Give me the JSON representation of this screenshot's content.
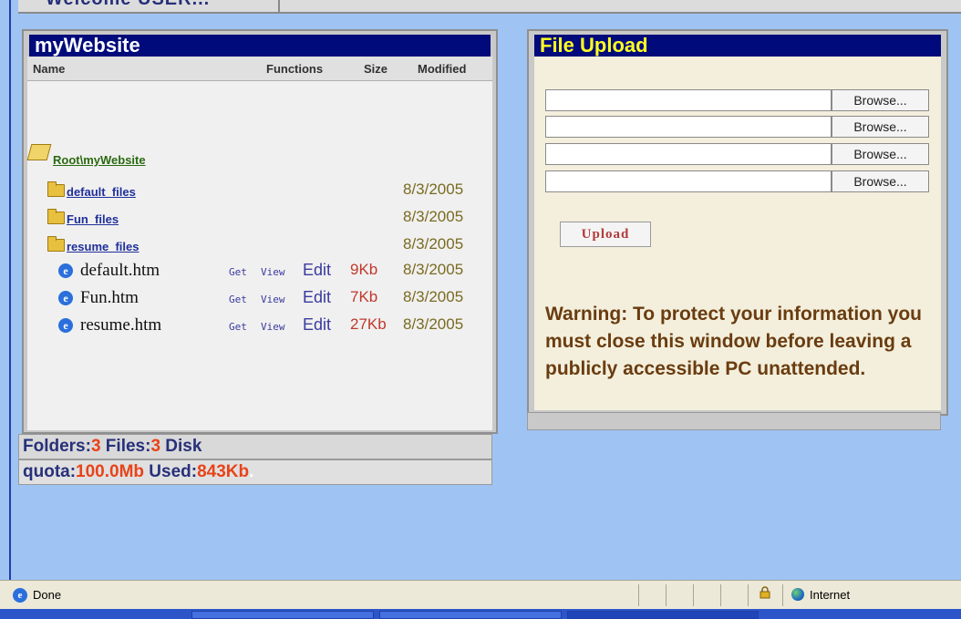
{
  "welcome_bar": {
    "label": "Welcome USER..."
  },
  "file_panel": {
    "title": "myWebsite",
    "columns": [
      "Name",
      "Functions",
      "Size",
      "Modified"
    ],
    "root": {
      "label": "Root\\myWebsite"
    },
    "folders": [
      {
        "name": "default_files",
        "modified": "8/3/2005"
      },
      {
        "name": "Fun_files",
        "modified": "8/3/2005"
      },
      {
        "name": "resume_files",
        "modified": "8/3/2005"
      }
    ],
    "files": [
      {
        "name": "default.htm",
        "get": "Get",
        "view": "View",
        "edit": "Edit",
        "size": "9Kb",
        "modified": "8/3/2005"
      },
      {
        "name": "Fun.htm",
        "get": "Get",
        "view": "View",
        "edit": "Edit",
        "size": "7Kb",
        "modified": "8/3/2005"
      },
      {
        "name": "resume.htm",
        "get": "Get",
        "view": "View",
        "edit": "Edit",
        "size": "27Kb",
        "modified": "8/3/2005"
      }
    ]
  },
  "quota": {
    "folders_label": "Folders:",
    "folders_count": "3",
    "files_label": " Files:",
    "files_count": "3",
    "disk_label": " Disk",
    "quota_label": "quota:",
    "quota_value": "100.0Mb",
    "used_label": " Used:",
    "used_value": "843Kb",
    "period": "."
  },
  "upload_panel": {
    "title": "File Upload",
    "inputs": [
      {
        "value": "",
        "browse_label": "Browse..."
      },
      {
        "value": "",
        "browse_label": "Browse..."
      },
      {
        "value": "",
        "browse_label": "Browse..."
      },
      {
        "value": "",
        "browse_label": "Browse..."
      }
    ],
    "upload_label": "Upload",
    "warning": "Warning: To protect your information you must close this window before leaving a publicly accessible PC unattended."
  },
  "statusbar": {
    "status": "Done",
    "zone": "Internet"
  },
  "icons": [
    "ie-page-icon",
    "folder-icon",
    "open-folder-icon",
    "lock-icon",
    "globe-icon"
  ],
  "colors": {
    "title_bar": "#000a7a",
    "upload_title": "#ffff22",
    "accent_red": "#e8431a",
    "background": "#9fc4f4"
  }
}
